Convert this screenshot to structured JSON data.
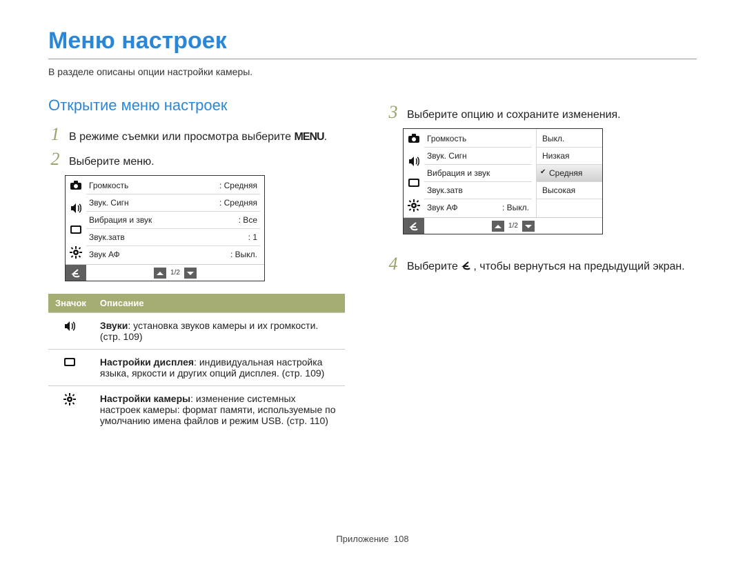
{
  "title": "Меню настроек",
  "subtitle": "В разделе описаны опции настройки камеры.",
  "left": {
    "section": "Открытие меню настроек",
    "step1": "В режиме съемки или просмотра выберите ",
    "step1_glyph": "MENU",
    "step2": "Выберите меню."
  },
  "screen1": {
    "rows": [
      {
        "label": "Громкость",
        "value": ": Средняя"
      },
      {
        "label": "Звук. Сигн",
        "value": ": Средняя"
      },
      {
        "label": "Вибрация и звук",
        "value": ": Все"
      },
      {
        "label": "Звук.затв",
        "value": ": 1"
      },
      {
        "label": "Звук АФ",
        "value": ": Выкл."
      }
    ],
    "pager": "1/2"
  },
  "desc": {
    "header_icon": "Значок",
    "header_desc": "Описание",
    "rows": [
      {
        "bold": "Звуки",
        "text": ": установка звуков камеры и их громкости. (стр. 109)"
      },
      {
        "bold": "Настройки дисплея",
        "text": ": индивидуальная настройка языка, яркости и других опций дисплея. (стр. 109)"
      },
      {
        "bold": "Настройки камеры",
        "text": ": изменение системных настроек камеры: формат памяти, используемые по умолчанию имена файлов и режим USB. (стр. 110)"
      }
    ]
  },
  "right": {
    "step3": "Выберите опцию и сохраните изменения.",
    "step4a": "Выберите ",
    "step4b": ", чтобы вернуться на предыдущий экран."
  },
  "screen2": {
    "rows": [
      {
        "label": "Громкость"
      },
      {
        "label": "Звук. Сигн"
      },
      {
        "label": "Вибрация и звук"
      },
      {
        "label": "Звук.затв"
      },
      {
        "label": "Звук АФ",
        "value": ": Выкл."
      }
    ],
    "options": [
      {
        "label": "Выкл."
      },
      {
        "label": "Низкая"
      },
      {
        "label": "Средняя",
        "selected": true
      },
      {
        "label": "Высокая"
      }
    ],
    "pager": "1/2"
  },
  "footer": {
    "section": "Приложение",
    "page": "108"
  }
}
